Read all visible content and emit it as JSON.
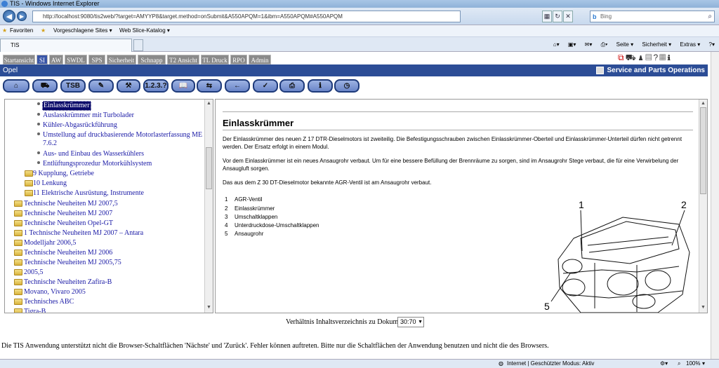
{
  "window": {
    "title": "TIS - Windows Internet Explorer"
  },
  "address": {
    "url": "http://localhost:9080/tis2web/?target=AMYYP8&target.method=onSubmit&A550APQM=1&ibm=A550APQM#A550APQM"
  },
  "search": {
    "placeholder": "Bing"
  },
  "favorites": {
    "label": "Favoriten",
    "suggested": "Vorgeschlagene Sites ▾",
    "webslice": "Web Slice-Katalog ▾"
  },
  "browser_tab": {
    "title": "TIS"
  },
  "commands": {
    "page": "Seite ▾",
    "security": "Sicherheit ▾",
    "extras": "Extras ▾"
  },
  "tis_tabs": [
    "Startansicht",
    "SI",
    "AW",
    "SWDL",
    "SPS",
    "Sicherheit",
    "Schnapp",
    "T2 Ansicht",
    "TL Druck",
    "RPO",
    "Admin"
  ],
  "brand": {
    "opel": "Opel",
    "spo": "Service and Parts Operations"
  },
  "toolbar": {
    "tsb": "TSB",
    "numbers": "1.2.3.?"
  },
  "tree": {
    "items": [
      {
        "label": "Einlasskrümmer"
      },
      {
        "label": "Auslasskrümmer mit Turbolader"
      },
      {
        "label": "Kühler-Abgasrückführung"
      },
      {
        "label": "Umstellung auf druckbasierende Motorlasterfassung ME"
      },
      {
        "label": "7.6.2"
      },
      {
        "label": "Aus- und Einbau des Wasserkühlers"
      },
      {
        "label": "Entlüftungsprozedur Motorkühlsystem"
      },
      {
        "label": "9  Kupplung, Getriebe"
      },
      {
        "label": "10  Lenkung"
      },
      {
        "label": "11  Elektrische Ausrüstung, Instrumente"
      },
      {
        "label": "Technische Neuheiten MJ 2007,5"
      },
      {
        "label": "Technische Neuheiten MJ 2007"
      },
      {
        "label": "Technische Neuheiten Opel-GT"
      },
      {
        "label": "1  Technische Neuheiten MJ 2007 – Antara"
      },
      {
        "label": "Modelljahr 2006,5"
      },
      {
        "label": "Technische Neuheiten MJ 2006"
      },
      {
        "label": "Technische Neuheiten MJ 2005,75"
      },
      {
        "label": "2005,5"
      },
      {
        "label": "Technische Neuheiten Zafira-B"
      },
      {
        "label": "Movano, Vivaro 2005"
      },
      {
        "label": "Technisches ABC"
      },
      {
        "label": "Tigra-B"
      }
    ]
  },
  "doc": {
    "title": "Einlasskrümmer",
    "p1": "Der Einlasskrümmer des neuen Z 17 DTR-Dieselmotors ist zweiteilig. Die Befestigungsschrauben zwischen Einlasskrümmer-Oberteil und Einlasskrümmer-Unterteil dürfen nicht getrennt werden. Der Ersatz erfolgt in einem Modul.",
    "p2": "Vor dem Einlasskrümmer ist ein neues Ansaugrohr verbaut. Um für eine bessere Befüllung der Brennräume zu sorgen, sind im Ansaugrohr Stege verbaut, die für eine Verwirbelung der Ansaugluft sorgen.",
    "p3": "Das aus dem Z 30 DT-Dieselmotor bekannte AGR-Ventil ist am Ansaugrohr verbaut.",
    "legend": [
      {
        "n": "1",
        "t": "AGR-Ventil"
      },
      {
        "n": "2",
        "t": "Einlasskrümmer"
      },
      {
        "n": "3",
        "t": "Umschaltklappen"
      },
      {
        "n": "4",
        "t": "Unterdruckdose-Umschaltklappen"
      },
      {
        "n": "5",
        "t": "Ansaugrohr"
      }
    ],
    "callouts": {
      "c1": "1",
      "c2": "2",
      "c5": "5"
    }
  },
  "ratio": {
    "label": "Verhältnis Inhaltsverzeichnis zu Dokument :",
    "value": "30:70"
  },
  "notice": "Die TIS Anwendung unterstützt nicht die Browser-Schaltflächen 'Nächste' und 'Zurück'. Fehler können auftreten. Bitte nur die Schaltflächen der Anwendung benutzen und nicht die des Browsers.",
  "status": {
    "zone": "Internet | Geschützter Modus: Aktiv",
    "zoom": "100%"
  }
}
